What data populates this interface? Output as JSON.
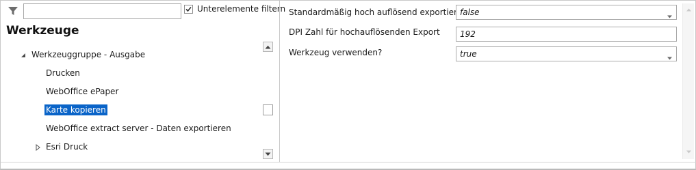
{
  "filter": {
    "input_value": "",
    "checkbox_label": "Unterelemente filtern",
    "checkbox_checked": true
  },
  "tree": {
    "title": "Werkzeuge",
    "group_label": "Werkzeuggruppe - Ausgabe",
    "items": [
      {
        "label": "Drucken"
      },
      {
        "label": "WebOffice ePaper"
      },
      {
        "label": "Karte kopieren",
        "selected": true
      },
      {
        "label": "WebOffice extract server - Daten exportieren"
      }
    ],
    "collapsed_group_label": "Esri Druck"
  },
  "properties": [
    {
      "label": "Standardmäßig hoch auflösend exportieren?",
      "value": "false",
      "type": "combo"
    },
    {
      "label": "DPI Zahl für hochauflösenden Export",
      "value": "192",
      "type": "text"
    },
    {
      "label": "Werkzeug verwenden?",
      "value": "true",
      "type": "combo"
    }
  ],
  "colors": {
    "selection": "#0a64c8",
    "border": "#a9a9a9"
  },
  "icons": {
    "filter": "funnel-icon",
    "checkbox_check": "checkmark-icon",
    "expanded": "triangle-expanded-icon",
    "collapsed": "triangle-collapsed-icon",
    "scroll_up": "arrow-up-icon",
    "scroll_down": "arrow-down-icon",
    "dropdown": "chevron-down-icon"
  }
}
